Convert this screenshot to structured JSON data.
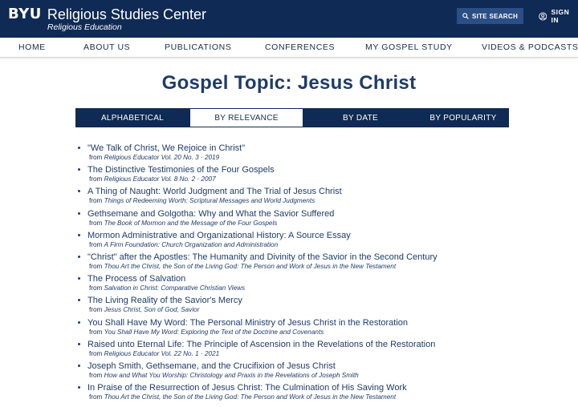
{
  "header": {
    "byu": "BYU",
    "title": "Religious Studies Center",
    "subtitle": "Religious Education",
    "search_label": "SITE SEARCH",
    "sign_in_label": "SIGN IN"
  },
  "nav": {
    "items": [
      "HOME",
      "ABOUT US",
      "PUBLICATIONS",
      "CONFERENCES",
      "MY GOSPEL STUDY",
      "VIDEOS & PODCASTS"
    ]
  },
  "page_title": "Gospel Topic: Jesus Christ",
  "tabs": [
    "ALPHABETICAL",
    "BY RELEVANCE",
    "BY DATE",
    "BY POPULARITY"
  ],
  "active_tab": "BY RELEVANCE",
  "from_prefix": "from",
  "results": [
    {
      "title": "\"We Talk of Christ, We Rejoice in Christ\"",
      "source": "Religious Educator Vol. 20 No. 3 · 2019"
    },
    {
      "title": "The Distinctive Testimonies of the Four Gospels",
      "source": "Religious Educator Vol. 8 No. 2 · 2007"
    },
    {
      "title": "A Thing of Naught: World Judgment and The Trial of Jesus Christ",
      "source": "Things of Redeeming Worth: Scriptural Messages and World Judgments"
    },
    {
      "title": "Gethsemane and Golgotha: Why and What the Savior Suffered",
      "source": "The Book of Mormon and the Message of the Four Gospels"
    },
    {
      "title": "Mormon Administrative and Organizational History: A Source Essay",
      "source": "A Firm Foundation: Church Organization and Administration"
    },
    {
      "title": "\"Christ\" after the Apostles: The Humanity and Divinity of the Savior in the Second Century",
      "source": "Thou Art the Christ, the Son of the Living God: The Person and Work of Jesus in the New Testament"
    },
    {
      "title": "The Process of Salvation",
      "source": "Salvation in Christ: Comparative Christian Views"
    },
    {
      "title": "The Living Reality of the Savior's Mercy",
      "source": "Jesus Christ, Son of God, Savior"
    },
    {
      "title": "You Shall Have My Word: The Personal Ministry of Jesus Christ in the Restoration",
      "source": "You Shall Have My Word: Exploring the Text of the Doctrine and Covenants"
    },
    {
      "title": "Raised unto Eternal Life: The Principle of Ascension in the Revelations of the Restoration",
      "source": "Religious Educator Vol. 22 No. 1 · 2021"
    },
    {
      "title": "Joseph Smith, Gethsemane, and the Crucifixion of Jesus Christ",
      "source": "How and What You Worship: Christology and Praxis in the Revelations of Joseph Smith"
    },
    {
      "title": "In Praise of the Resurrection of Jesus Christ: The Culmination of His Saving Work",
      "source": "Thou Art the Christ, the Son of the Living God: The Person and Work of Jesus in the New Testament"
    }
  ],
  "colors": {
    "header_bg": "#0f2a54",
    "accent": "#2b4e86",
    "link": "#1f3b6b"
  },
  "icons": {
    "search": "search-icon",
    "user": "user-circle-icon"
  }
}
